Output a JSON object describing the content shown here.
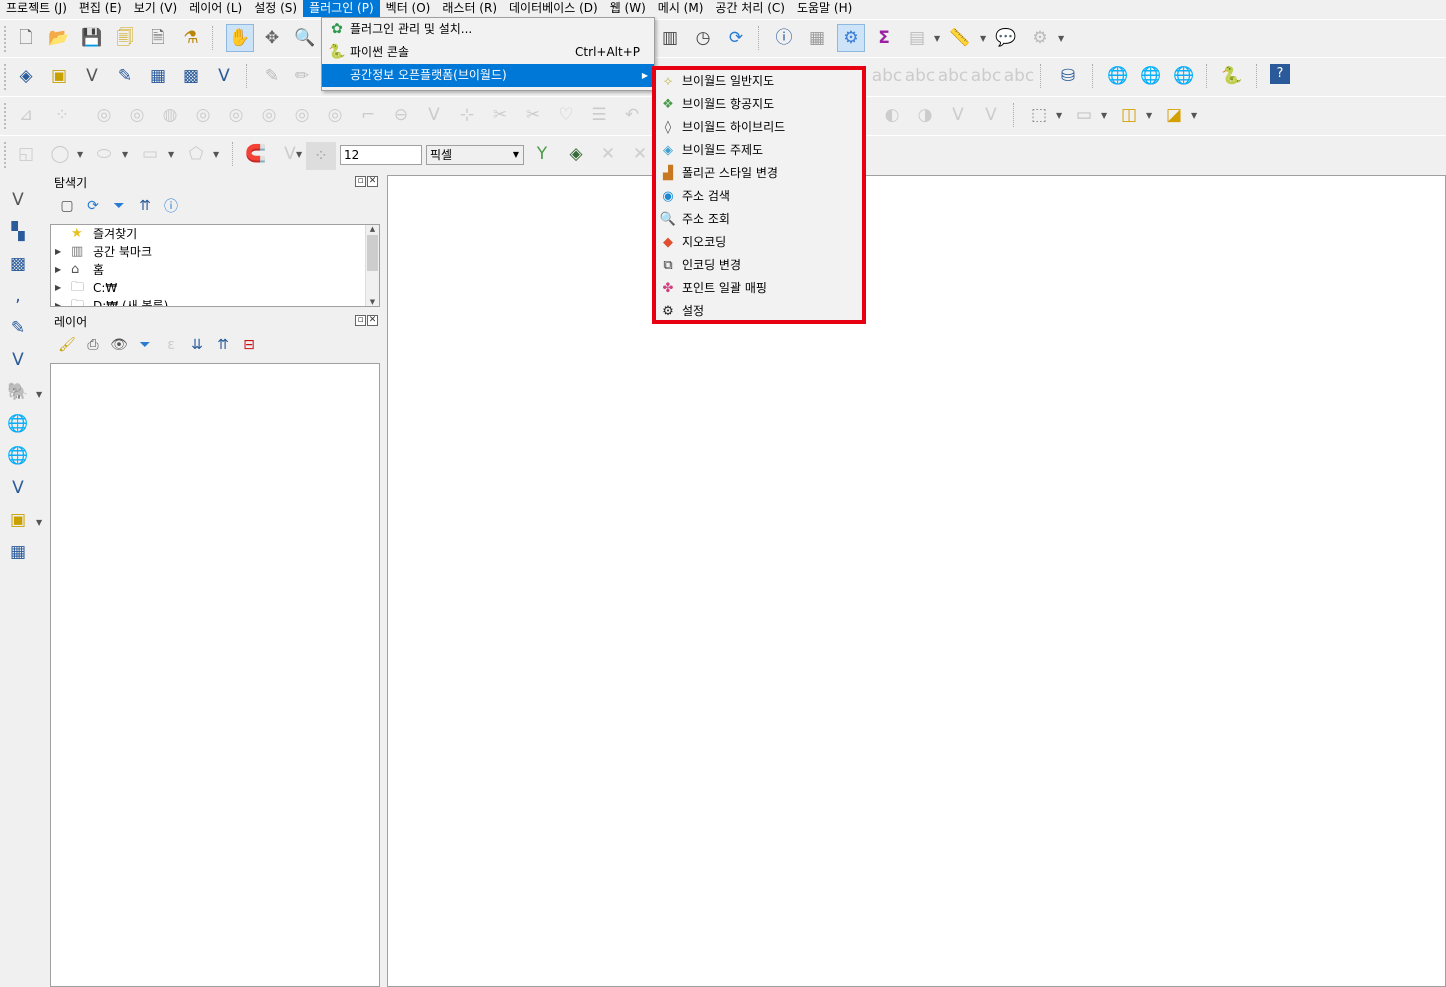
{
  "menubar": [
    "프로젝트 (J)",
    "편집 (E)",
    "보기 (V)",
    "레이어 (L)",
    "설정 (S)",
    "플러그인 (P)",
    "벡터 (O)",
    "래스터 (R)",
    "데이터베이스 (D)",
    "웹 (W)",
    "메시 (M)",
    "공간 처리 (C)",
    "도움말 (H)"
  ],
  "plugin_menu": {
    "items": [
      {
        "label": "플러그인 관리 및 설치...",
        "icon": "puzzle-icon",
        "shortcut": ""
      },
      {
        "label": "파이썬 콘솔",
        "icon": "python-icon",
        "shortcut": "Ctrl+Alt+P"
      },
      {
        "label": "공간정보 오픈플랫폼(브이월드)",
        "icon": "",
        "shortcut": ""
      }
    ]
  },
  "vworld_submenu": {
    "items": [
      {
        "label": "브이월드 일반지도",
        "icon": "base-map-icon"
      },
      {
        "label": "브이월드 항공지도",
        "icon": "satellite-map-icon"
      },
      {
        "label": "브이월드 하이브리드",
        "icon": "hybrid-map-icon"
      },
      {
        "label": "브이월드 주제도",
        "icon": "thematic-map-icon"
      },
      {
        "label": "폴리곤 스타일 변경",
        "icon": "polygon-style-icon"
      },
      {
        "label": "주소 검색",
        "icon": "address-search-icon"
      },
      {
        "label": "주소 조회",
        "icon": "address-lookup-icon"
      },
      {
        "label": "지오코딩",
        "icon": "geocoding-icon"
      },
      {
        "label": "인코딩 변경",
        "icon": "encoding-icon"
      },
      {
        "label": "포인트 일괄 매핑",
        "icon": "point-mapping-icon"
      },
      {
        "label": "설정",
        "icon": "settings-gear-icon"
      }
    ]
  },
  "snapping": {
    "tolerance": "12",
    "unit": "픽셀"
  },
  "browser_panel": {
    "title": "탐색기",
    "items": [
      {
        "label": "즐겨찾기",
        "icon": "star-icon",
        "expandable": false
      },
      {
        "label": "공간 북마크",
        "icon": "bookmark-icon",
        "expandable": true
      },
      {
        "label": "홈",
        "icon": "home-folder-icon",
        "expandable": true
      },
      {
        "label": "C:₩",
        "icon": "folder-icon",
        "expandable": true
      },
      {
        "label": "D:₩ (새 볼륨)",
        "icon": "folder-icon",
        "expandable": true
      }
    ]
  },
  "layers_panel": {
    "title": "레이어"
  },
  "colors": {
    "accent": "#0078d7",
    "highlight_box": "#e60012"
  }
}
